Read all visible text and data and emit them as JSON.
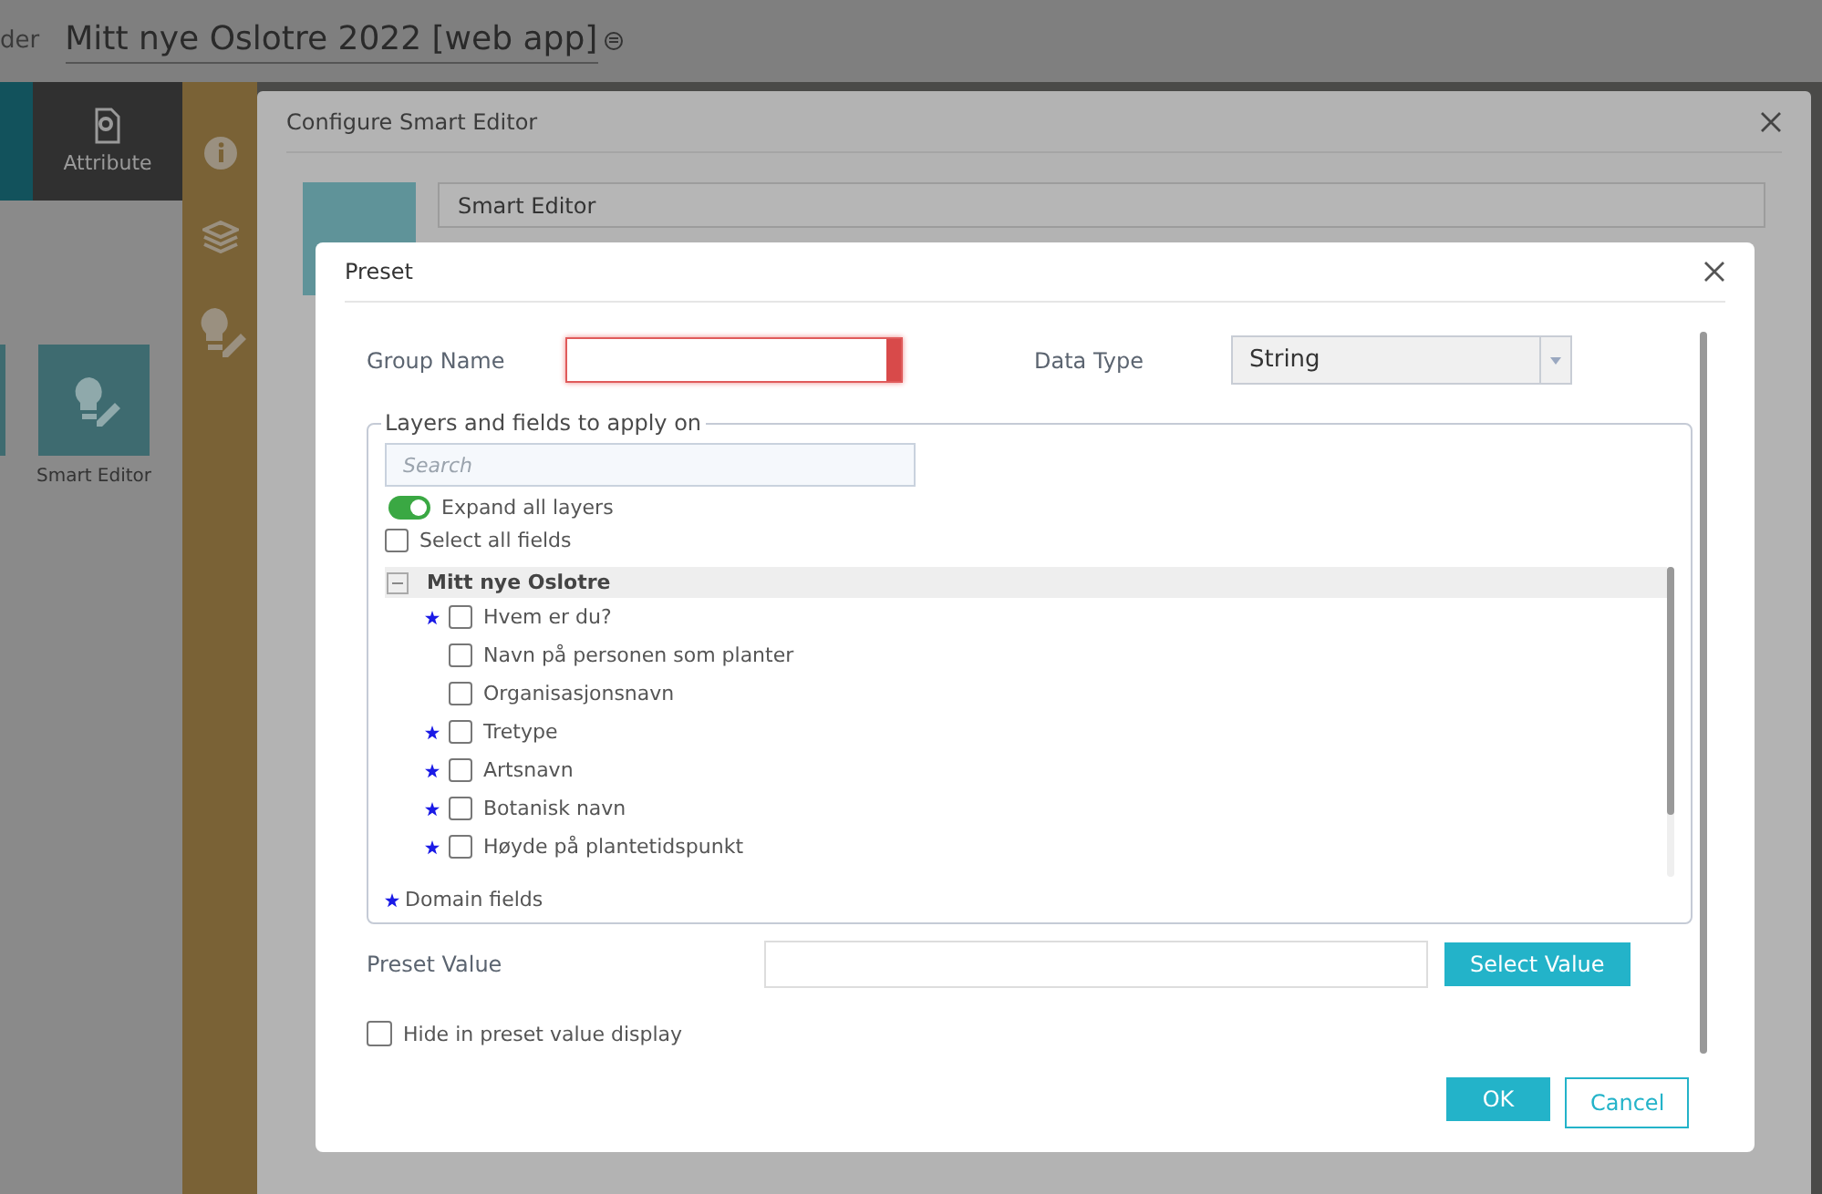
{
  "top_bar": {
    "partial_label": "der",
    "title": "Mitt nye Oslotre 2022 [web app]"
  },
  "left_panel": {
    "tab": {
      "label": "Attribute"
    },
    "widget": {
      "label": "Smart Editor"
    }
  },
  "config_dialog": {
    "title": "Configure Smart Editor",
    "name_value": "Smart Editor"
  },
  "preset_dialog": {
    "title": "Preset",
    "group_name": {
      "label": "Group Name",
      "invalid": true
    },
    "data_type": {
      "label": "Data Type",
      "value": "String"
    },
    "fieldset": {
      "legend": "Layers and fields to apply on",
      "search_placeholder": "Search",
      "expand_all": {
        "label": "Expand all layers",
        "on": true
      },
      "select_all": {
        "label": "Select all fields",
        "checked": false
      },
      "layers": [
        {
          "name": "Mitt nye Oslotre",
          "expanded": true,
          "children": [
            {
              "name": "Hvem er du?",
              "domain": true,
              "checked": false
            },
            {
              "name": "Navn på personen som planter",
              "domain": false,
              "checked": false
            },
            {
              "name": "Organisasjonsnavn",
              "domain": false,
              "checked": false
            },
            {
              "name": "Tretype",
              "domain": true,
              "checked": false
            },
            {
              "name": "Artsnavn",
              "domain": true,
              "checked": false
            },
            {
              "name": "Botanisk navn",
              "domain": true,
              "checked": false
            },
            {
              "name": "Høyde på plantetidspunkt",
              "domain": true,
              "checked": false
            }
          ]
        }
      ],
      "domain_note": "Domain fields"
    },
    "preset_value": {
      "label": "Preset Value",
      "button": "Select Value"
    },
    "hide_option": {
      "label": "Hide in preset value display",
      "checked": false
    },
    "buttons": {
      "ok": "OK",
      "cancel": "Cancel"
    }
  }
}
